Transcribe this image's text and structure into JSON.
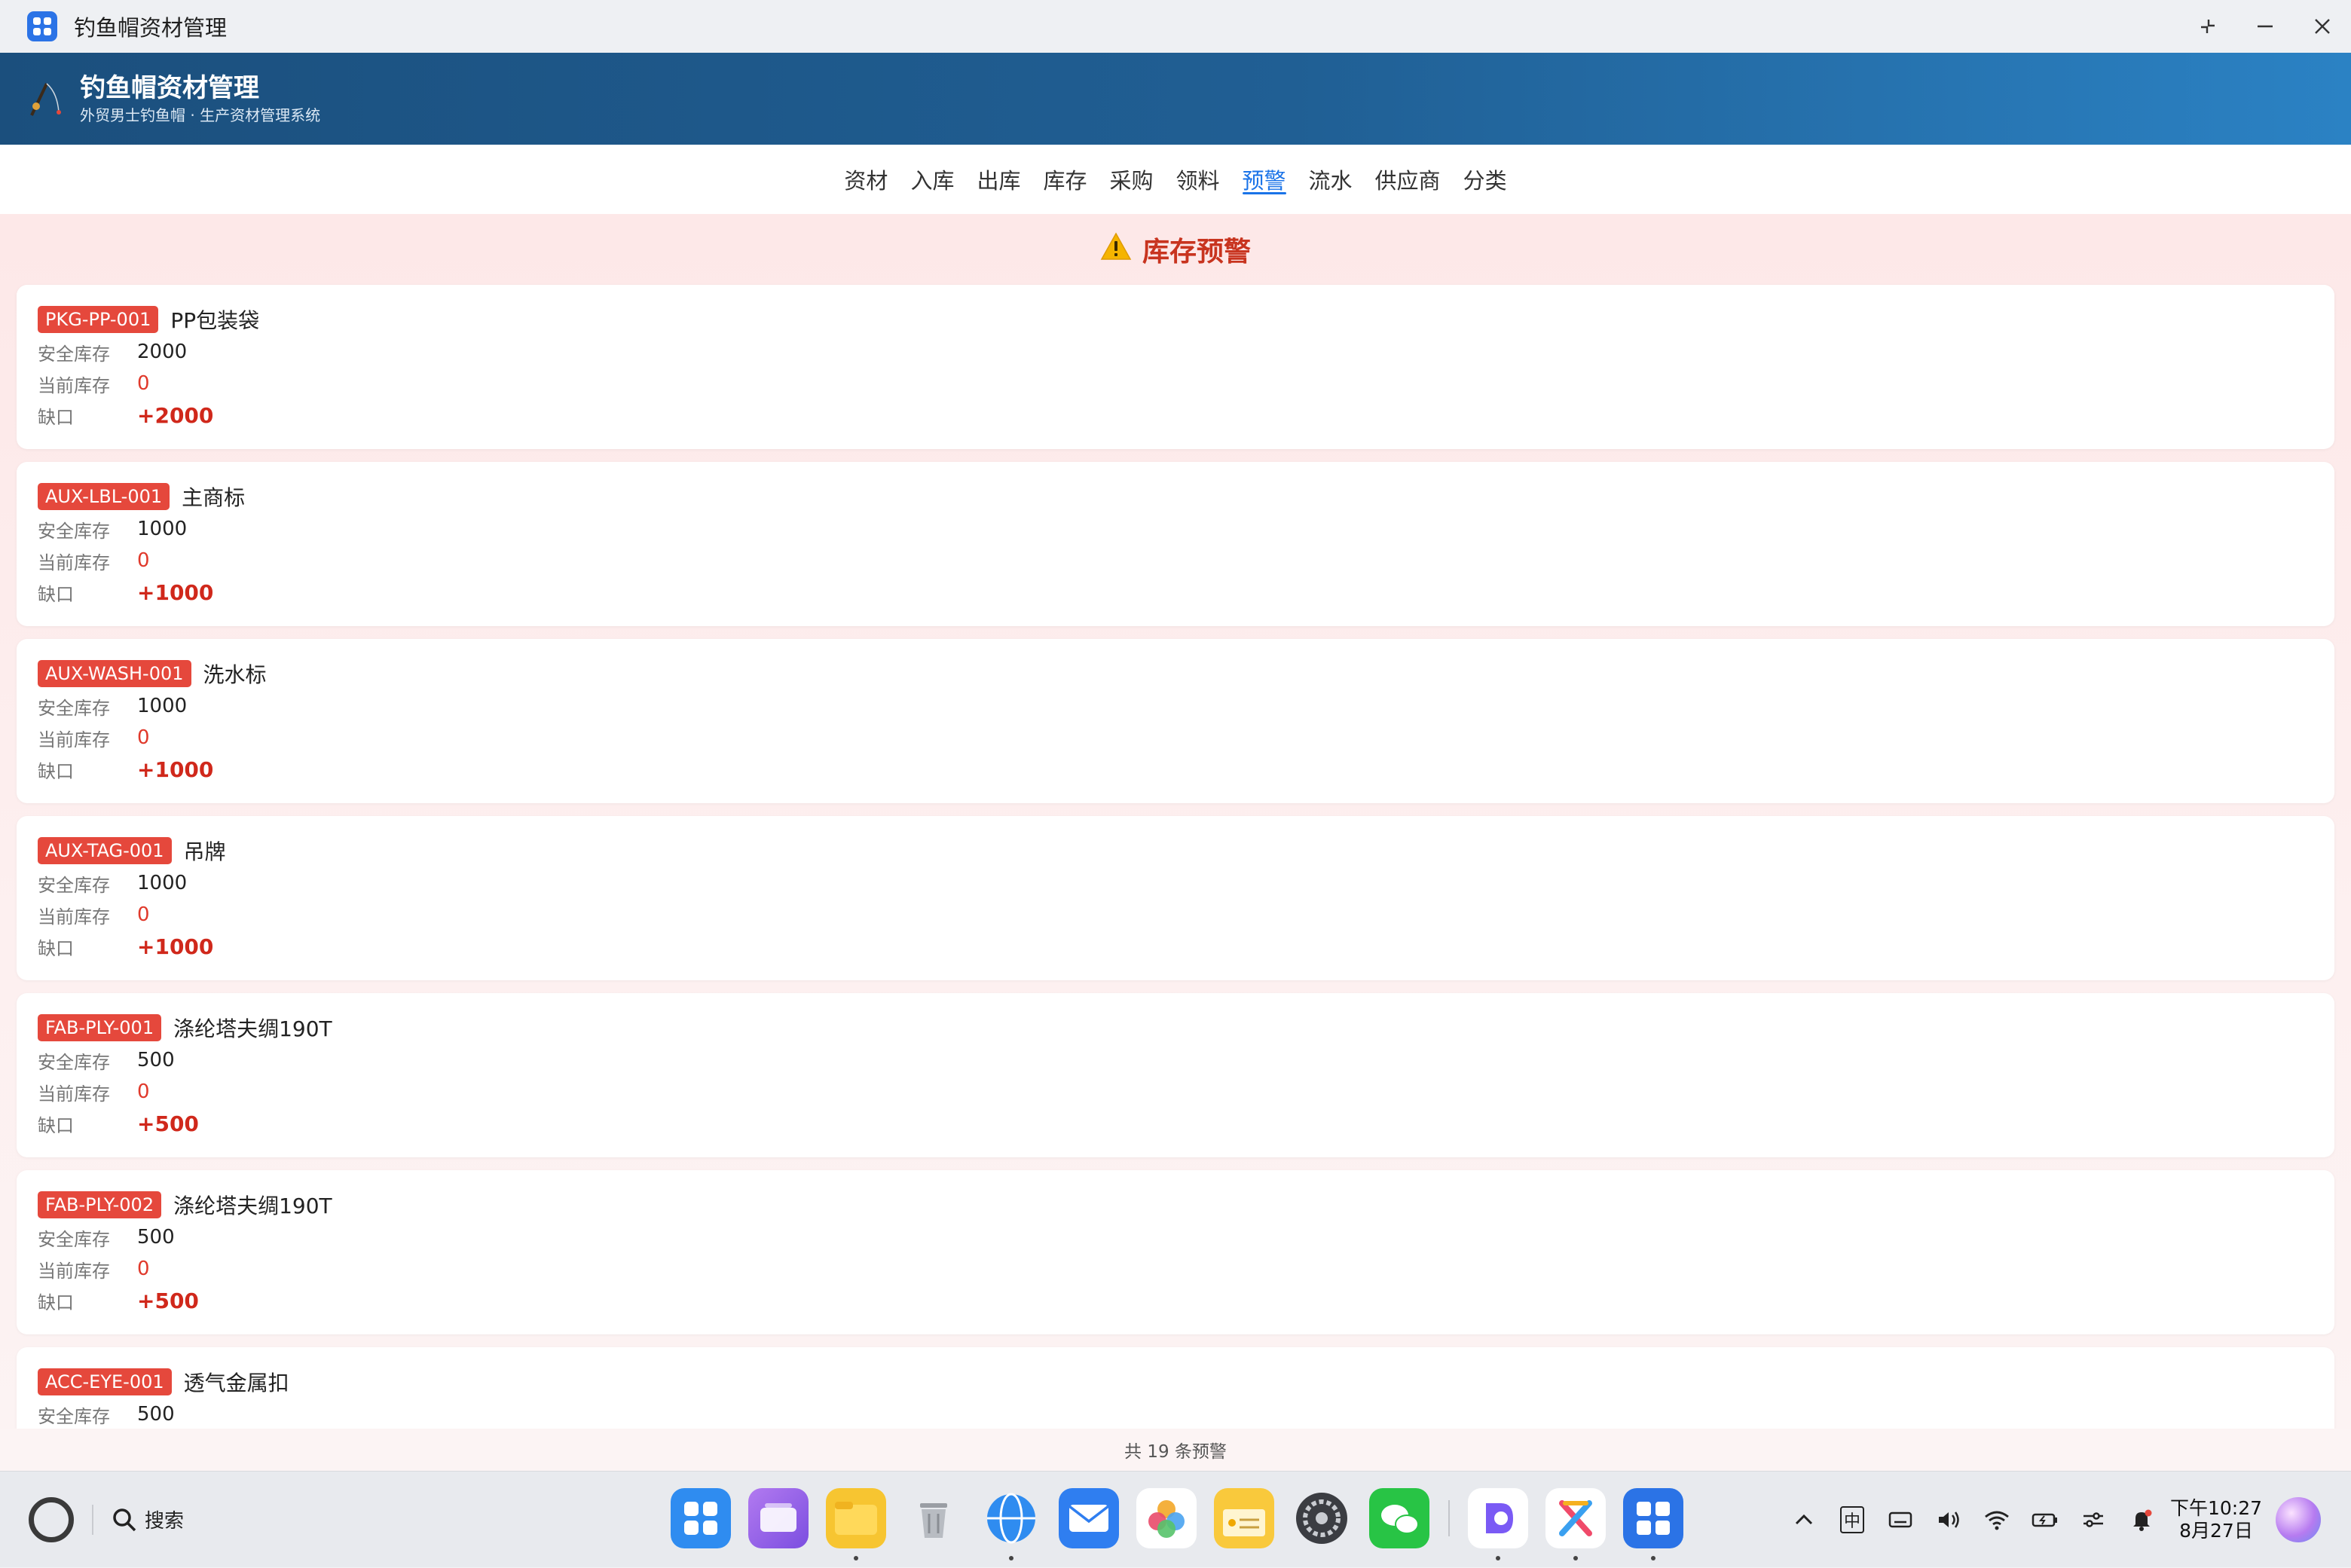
{
  "window": {
    "title": "钓鱼帽资材管理",
    "controls": [
      "restore-icon",
      "minimize-icon",
      "close-icon"
    ]
  },
  "header": {
    "app_name": "钓鱼帽资材管理",
    "subtitle": "外贸男士钓鱼帽 · 生产资材管理系统",
    "gradient_colors": [
      "#1b4f7d",
      "#2b82c4"
    ]
  },
  "nav": {
    "tabs": [
      {
        "label": "资材"
      },
      {
        "label": "入库"
      },
      {
        "label": "出库"
      },
      {
        "label": "库存"
      },
      {
        "label": "采购"
      },
      {
        "label": "领料"
      },
      {
        "label": "预警"
      },
      {
        "label": "流水"
      },
      {
        "label": "供应商"
      },
      {
        "label": "分类"
      }
    ],
    "active": "预警",
    "active_color": "#1a73e8"
  },
  "alerts": {
    "title": "库存预警",
    "labels": {
      "safety": "安全库存",
      "current": "当前库存",
      "gap": "缺口"
    },
    "accent_color": "#e5483c",
    "items": [
      {
        "code": "PKG-PP-001",
        "name": "PP包装袋",
        "safety": "2000",
        "current": "0",
        "gap": "+2000"
      },
      {
        "code": "AUX-LBL-001",
        "name": "主商标",
        "safety": "1000",
        "current": "0",
        "gap": "+1000"
      },
      {
        "code": "AUX-WASH-001",
        "name": "洗水标",
        "safety": "1000",
        "current": "0",
        "gap": "+1000"
      },
      {
        "code": "AUX-TAG-001",
        "name": "吊牌",
        "safety": "1000",
        "current": "0",
        "gap": "+1000"
      },
      {
        "code": "FAB-PLY-001",
        "name": "涤纶塔夫绸190T",
        "safety": "500",
        "current": "0",
        "gap": "+500"
      },
      {
        "code": "FAB-PLY-002",
        "name": "涤纶塔夫绸190T",
        "safety": "500",
        "current": "0",
        "gap": "+500"
      },
      {
        "code": "ACC-EYE-001",
        "name": "透气金属扣",
        "safety": "500",
        "current": "",
        "gap": ""
      }
    ],
    "footer": "共 19 条预警"
  },
  "taskbar": {
    "search_label": "搜索",
    "dock_apps": [
      "app-center-icon",
      "multitask-icon",
      "files-icon",
      "trash-icon",
      "browser-icon",
      "mail-icon",
      "photos-icon",
      "notes-icon",
      "settings-icon",
      "wechat-icon",
      "design-app-icon",
      "creative-app-icon",
      "materials-app-icon"
    ],
    "tray": {
      "ime": "中",
      "time": "下午10:27",
      "date": "8月27日"
    }
  }
}
